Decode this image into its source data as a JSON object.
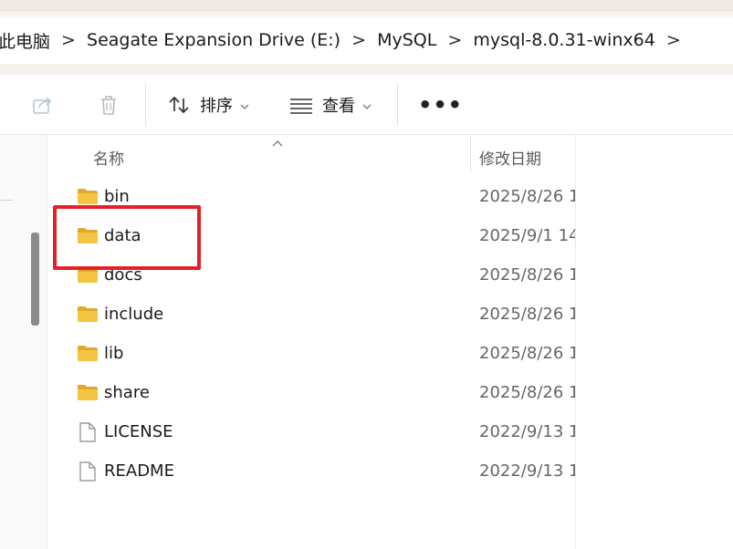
{
  "breadcrumb": {
    "items": [
      "此电脑",
      "Seagate Expansion Drive (E:)",
      "MySQL",
      "mysql-8.0.31-winx64"
    ],
    "separator": ">"
  },
  "toolbar": {
    "share_icon": "share-icon",
    "delete_icon": "trash-icon",
    "sort_label": "排序",
    "view_label": "查看",
    "more_label": "•••"
  },
  "columns": {
    "name": "名称",
    "date": "修改日期"
  },
  "files": [
    {
      "name": "bin",
      "date": "2025/8/26 1",
      "type": "folder"
    },
    {
      "name": "data",
      "date": "2025/9/1 14",
      "type": "folder"
    },
    {
      "name": "docs",
      "date": "2025/8/26 1",
      "type": "folder"
    },
    {
      "name": "include",
      "date": "2025/8/26 1",
      "type": "folder"
    },
    {
      "name": "lib",
      "date": "2025/8/26 1",
      "type": "folder"
    },
    {
      "name": "share",
      "date": "2025/8/26 1",
      "type": "folder"
    },
    {
      "name": "LICENSE",
      "date": "2022/9/13 1",
      "type": "file"
    },
    {
      "name": "README",
      "date": "2022/9/13 1",
      "type": "file"
    }
  ],
  "colors": {
    "highlight": "#e5202b",
    "folder": "#f4c542",
    "folder_dark": "#e0a92a"
  }
}
